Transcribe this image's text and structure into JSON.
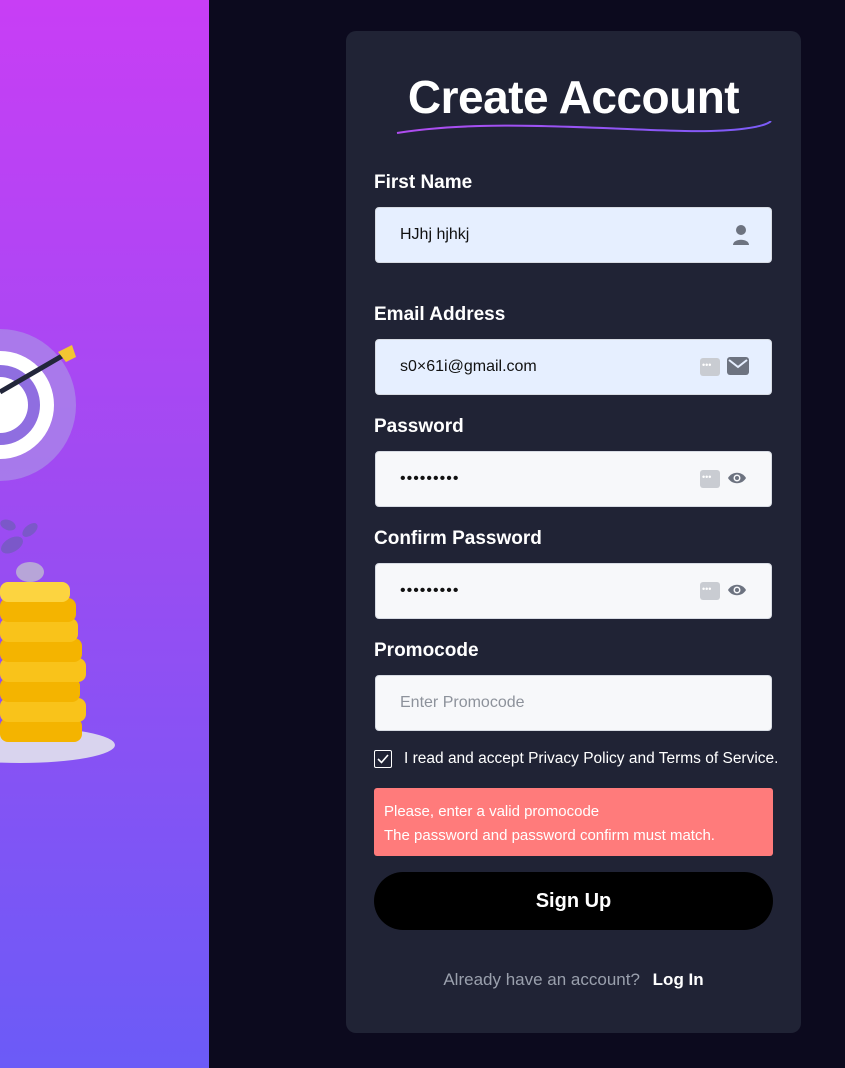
{
  "title": "Create Account",
  "fields": {
    "first_name": {
      "label": "First Name",
      "value": "HJhj hjhkj"
    },
    "email": {
      "label": "Email Address",
      "value": "s0×61i@gmail.com"
    },
    "password": {
      "label": "Password",
      "value": "•••••••••"
    },
    "confirm_password": {
      "label": "Confirm Password",
      "value": "•••••••••"
    },
    "promocode": {
      "label": "Promocode",
      "placeholder": "Enter Promocode",
      "value": ""
    }
  },
  "terms": {
    "label": "I read and accept Privacy Policy and Terms of Service.",
    "checked": true
  },
  "errors": [
    "Please, enter a valid promocode",
    "The password and password confirm must match."
  ],
  "signup_label": "Sign Up",
  "footer": {
    "text": "Already have an account?",
    "link": "Log In"
  },
  "colors": {
    "card": "#202335",
    "page_bg": "#0c0a1e",
    "error": "#ff7b7b",
    "accent_gradient": [
      "#c83ef5",
      "#6b5bf7"
    ]
  },
  "icons": [
    "user-icon",
    "envelope-icon",
    "eye-icon",
    "autofill-key-icon",
    "checkmark-icon"
  ]
}
